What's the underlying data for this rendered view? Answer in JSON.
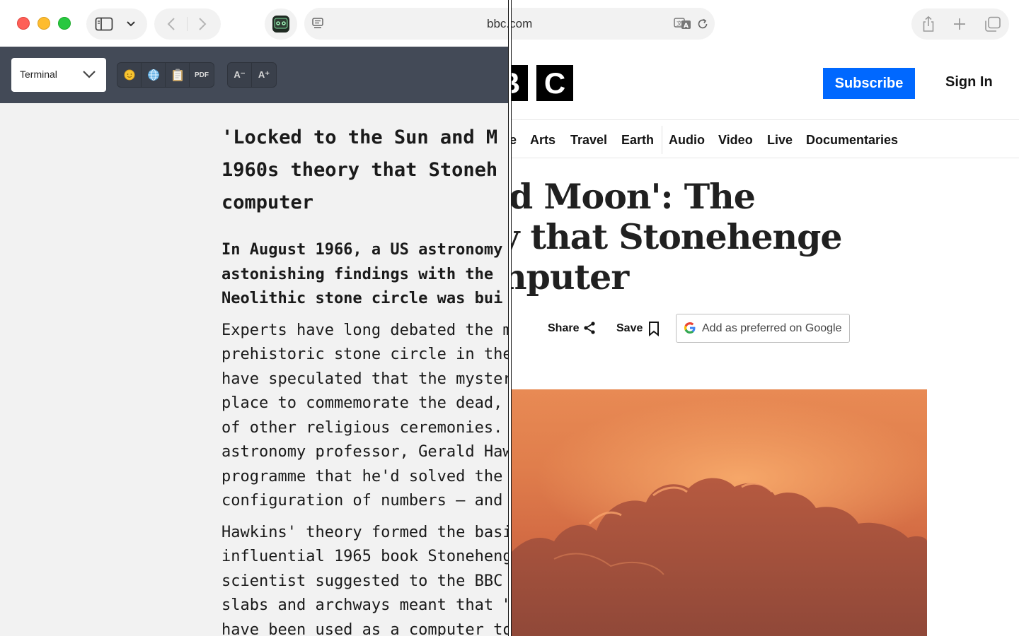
{
  "browser": {
    "address": "bbc.com"
  },
  "reader": {
    "font_select": "Terminal",
    "tools": {
      "pdf_label": "PDF",
      "font_smaller": "A⁻",
      "font_larger": "A⁺"
    },
    "title_lines": [
      "'Locked to the Sun and M",
      "1960s theory that Stoneh",
      "computer"
    ],
    "intro_lines": [
      "In August 1966, a US astronomy",
      "astonishing findings with the",
      "Neolithic stone circle was bui"
    ],
    "para2_lines": [
      "Experts have long debated the m",
      "prehistoric stone circle in the",
      "have speculated that the myster",
      "place to commemorate the dead,",
      "of other religious ceremonies.",
      "astronomy professor, Gerald Haw",
      "programme that he'd solved the",
      "configuration of numbers – and"
    ],
    "para3_lines": [
      "Hawkins' theory formed the basi",
      "influential 1965 book Stoneheng",
      "scientist suggested to the BBC",
      "slabs and archways meant that \"",
      "have been used as a computer to"
    ]
  },
  "bbc": {
    "logo_letters": [
      "B",
      "C"
    ],
    "subscribe": "Subscribe",
    "sign_in": "Sign In",
    "nav": [
      "e",
      "Arts",
      "Travel",
      "Earth",
      "Audio",
      "Video",
      "Live",
      "Documentaries"
    ],
    "headline_lines": [
      "d Moon': The",
      "y that Stonehenge",
      "nputer"
    ],
    "share": "Share",
    "save": "Save",
    "google_pref": "Add as preferred on Google"
  }
}
